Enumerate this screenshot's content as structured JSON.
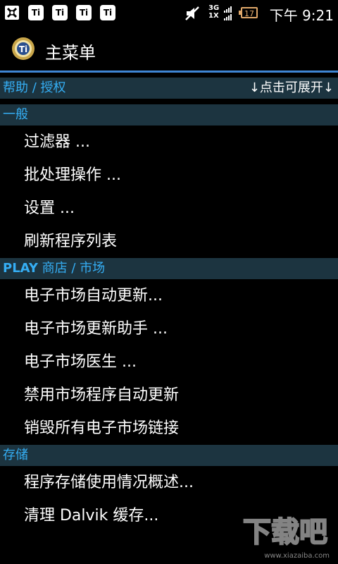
{
  "status_bar": {
    "notif_icons": [
      "usb-debug-icon",
      "ti-icon",
      "ti-icon",
      "ti-icon",
      "ti-icon"
    ],
    "ti_label": "Ti",
    "network_top": "3G",
    "network_bottom": "1X",
    "battery_level": "17",
    "time": "下午 9:21"
  },
  "app": {
    "title": "主菜单"
  },
  "sections": [
    {
      "header_prefix": "帮助 / 授权",
      "expand_hint": "↓点击可展开↓",
      "items": []
    },
    {
      "header_prefix": "一般",
      "items": [
        "过滤器 ...",
        "批处理操作 ...",
        "设置 ...",
        "刷新程序列表"
      ]
    },
    {
      "header_bold": "PLAY",
      "header_prefix": " 商店 / 市场",
      "items": [
        "电子市场自动更新...",
        "电子市场更新助手 ...",
        "电子市场医生 ...",
        "禁用市场程序自动更新",
        "销毁所有电子市场链接"
      ]
    },
    {
      "header_prefix": "存储",
      "items": [
        "程序存储使用情况概述...",
        "清理 Dalvik 缓存..."
      ]
    }
  ],
  "watermark": {
    "text": "下载吧",
    "url": "www.xiazaiba.com"
  },
  "colors": {
    "accent": "#3f86d4",
    "section_bg": "#1c3440",
    "section_text": "#35aef4",
    "battery": "#e0a86a"
  }
}
